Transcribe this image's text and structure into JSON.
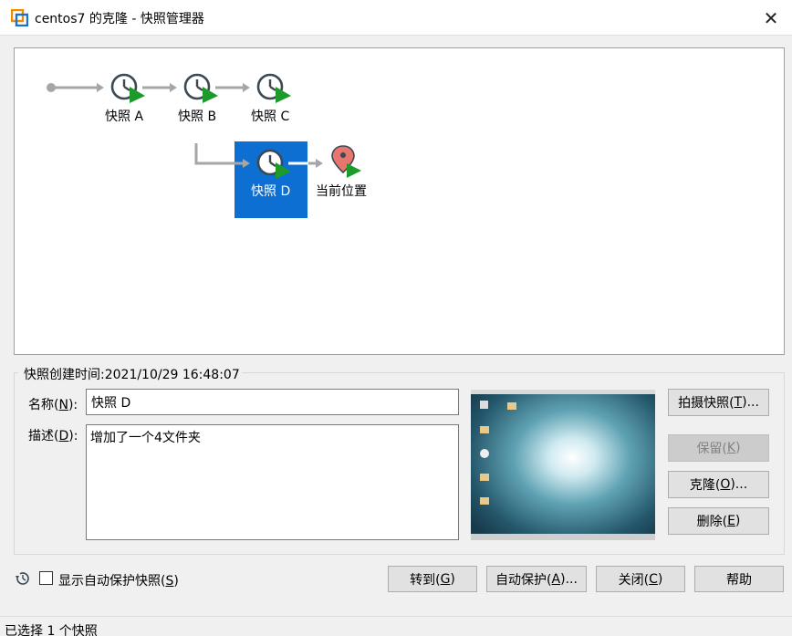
{
  "window": {
    "title": "centos7 的克隆 - 快照管理器",
    "close_glyph": "✕"
  },
  "tree": {
    "nodes": [
      {
        "label": "快照 A",
        "icon": "snapshot-clock-icon"
      },
      {
        "label": "快照 B",
        "icon": "snapshot-clock-icon"
      },
      {
        "label": "快照 C",
        "icon": "snapshot-clock-icon"
      },
      {
        "label": "快照 D",
        "icon": "snapshot-clock-icon",
        "selected": true
      },
      {
        "label": "当前位置",
        "icon": "current-location-pin-icon"
      }
    ]
  },
  "details": {
    "created_label": "快照创建时间:2021/10/29 16:48:07",
    "name_label_pre": "名称(",
    "name_label_key": "N",
    "name_label_post": "):",
    "name_value": "快照 D",
    "desc_label_pre": "描述(",
    "desc_label_key": "D",
    "desc_label_post": "):",
    "desc_value": "增加了一个4文件夹"
  },
  "side_buttons": {
    "take_snapshot": {
      "pre": "拍摄快照(",
      "key": "T",
      "post": ")..."
    },
    "keep": {
      "pre": "保留(",
      "key": "K",
      "post": ")"
    },
    "clone": {
      "pre": "克隆(",
      "key": "O",
      "post": ")..."
    },
    "delete": {
      "pre": "删除(",
      "key": "E",
      "post": ")"
    }
  },
  "bottom": {
    "show_auto_pre": "显示自动保护快照(",
    "show_auto_key": "S",
    "show_auto_post": ")",
    "show_auto_checked": false,
    "goto": {
      "pre": "转到(",
      "key": "G",
      "post": ")"
    },
    "autoprotect": {
      "pre": "自动保护(",
      "key": "A",
      "post": ")..."
    },
    "close": {
      "pre": "关闭(",
      "key": "C",
      "post": ")"
    },
    "help": "帮助"
  },
  "status": "已选择 1 个快照",
  "colors": {
    "selection": "#0d6fd1",
    "arrow": "#a6a6a6",
    "play_green": "#1e9a2a",
    "pin_red": "#e8766f"
  }
}
